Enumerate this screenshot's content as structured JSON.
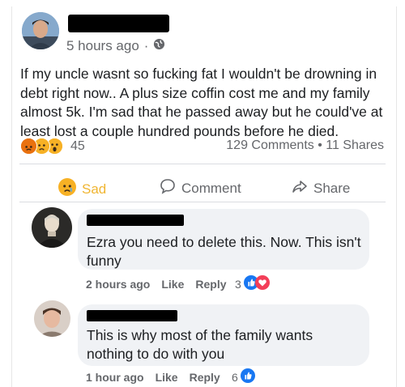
{
  "post": {
    "time": "5 hours ago",
    "privacy_sep": "·",
    "text": "If my uncle wasnt so fucking fat I wouldn't be drowning in debt right now.. A plus size coffin cost me and my family almost 5k. I'm sad that he passed away but he could've at least lost a couple hundred pounds before he died.",
    "reaction_count": "45",
    "stats": "129 Comments • 11 Shares"
  },
  "actions": {
    "sad": "Sad",
    "comment": "Comment",
    "share": "Share"
  },
  "comments": [
    {
      "text": "Ezra you need to delete this. Now. This isn't funny",
      "time": "2 hours ago",
      "like": "Like",
      "reply": "Reply",
      "reaction_count": "3"
    },
    {
      "text": "This is why most of the family wants nothing to do with you",
      "time": "1 hour ago",
      "like": "Like",
      "reply": "Reply",
      "reaction_count": "6"
    }
  ],
  "colors": {
    "like_blue": "#1877f2",
    "love_red": "#f33e58",
    "sad_yellow": "#f0b531",
    "meta_gray": "#65676b"
  },
  "icons": [
    "globe-icon",
    "sad-reaction-icon",
    "angry-reaction-icon",
    "wow-reaction-icon",
    "comment-icon",
    "share-icon",
    "like-reaction-icon",
    "love-reaction-icon"
  ]
}
